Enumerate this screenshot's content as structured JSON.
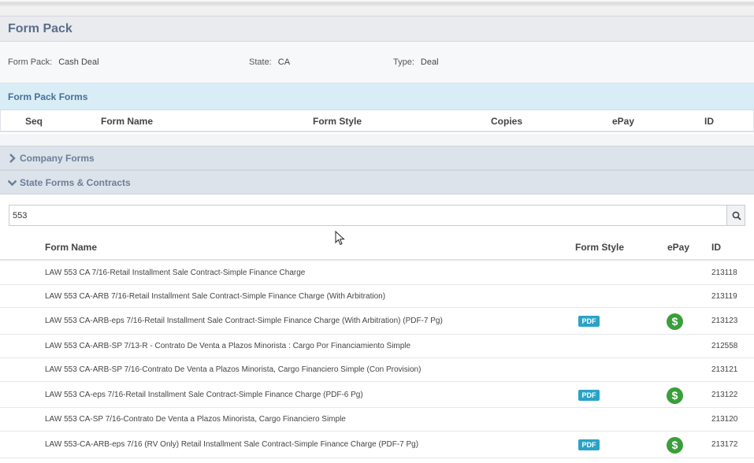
{
  "page": {
    "title": "Form Pack"
  },
  "info": {
    "form_pack_label": "Form Pack:",
    "form_pack_value": "Cash Deal",
    "state_label": "State:",
    "state_value": "CA",
    "type_label": "Type:",
    "type_value": "Deal"
  },
  "form_pack_forms": {
    "title": "Form Pack Forms",
    "columns": {
      "seq": "Seq",
      "form_name": "Form Name",
      "form_style": "Form Style",
      "copies": "Copies",
      "epay": "ePay",
      "id": "ID"
    }
  },
  "sections": {
    "company_forms": {
      "title": "Company Forms",
      "icon": "chevron-right-icon"
    },
    "state_forms": {
      "title": "State Forms & Contracts",
      "icon": "chevron-down-icon"
    }
  },
  "search": {
    "value": "553",
    "icon": "search-icon"
  },
  "list": {
    "columns": {
      "form_name": "Form Name",
      "form_style": "Form Style",
      "epay": "ePay",
      "id": "ID"
    },
    "rows": [
      {
        "name": "LAW 553 CA 7/16-Retail Installment Sale Contract-Simple Finance Charge",
        "style": "",
        "epay": false,
        "id": "213118"
      },
      {
        "name": "LAW 553 CA-ARB 7/16-Retail Installment Sale Contract-Simple Finance Charge (With Arbitration)",
        "style": "",
        "epay": false,
        "id": "213119"
      },
      {
        "name": "LAW 553 CA-ARB-eps 7/16-Retail Installment Sale Contract-Simple Finance Charge (With Arbitration) (PDF-7 Pg)",
        "style": "PDF",
        "epay": true,
        "id": "213123"
      },
      {
        "name": "LAW 553 CA-ARB-SP 7/13-R - Contrato De Venta a Plazos Minorista : Cargo Por Financiamiento Simple",
        "style": "",
        "epay": false,
        "id": "212558"
      },
      {
        "name": "LAW 553 CA-ARB-SP 7/16-Contrato De Venta a Plazos Minorista, Cargo Financiero Simple (Con Provision)",
        "style": "",
        "epay": false,
        "id": "213121"
      },
      {
        "name": "LAW 553 CA-eps 7/16-Retail Installment Sale Contract-Simple Finance Charge (PDF-6 Pg)",
        "style": "PDF",
        "epay": true,
        "id": "213122"
      },
      {
        "name": "LAW 553 CA-SP 7/16-Contrato De Venta a Plazos Minorista, Cargo Financiero Simple",
        "style": "",
        "epay": false,
        "id": "213120"
      },
      {
        "name": "LAW 553-CA-ARB-eps 7/16 (RV Only) Retail Installment Sale Contract-Simple Finance Charge (PDF-7 Pg)",
        "style": "PDF",
        "epay": true,
        "id": "213172"
      }
    ],
    "epay_symbol": "$",
    "epay_icon": "dollar-icon"
  }
}
